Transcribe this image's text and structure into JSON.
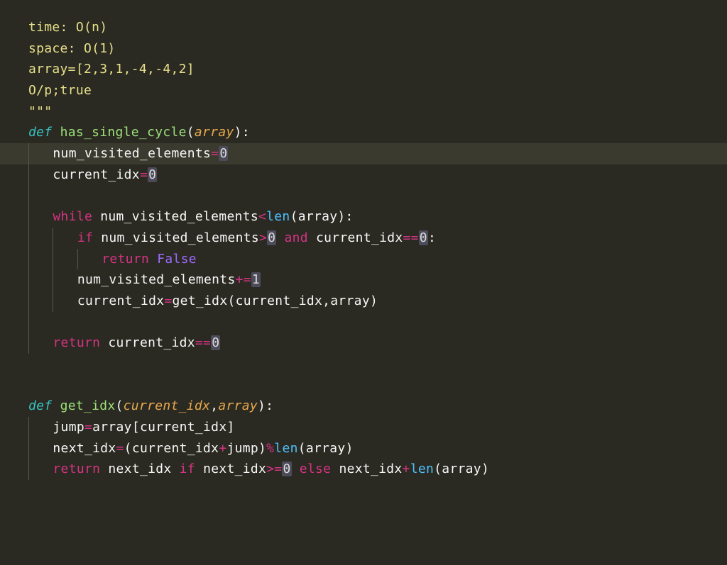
{
  "docstring": {
    "line1": "time: O(n)",
    "line2": "space: O(1)",
    "line3": "",
    "line4": "array=[2,3,1,-4,-4,2]",
    "line5": "O/p;true",
    "line6": "",
    "close": "\"\"\""
  },
  "kw": {
    "def": "def",
    "while": "while",
    "if": "if",
    "and": "and",
    "return": "return",
    "else": "else"
  },
  "fn": {
    "has_single_cycle": "has_single_cycle",
    "get_idx": "get_idx",
    "len": "len"
  },
  "param": {
    "array": "array",
    "current_idx": "current_idx"
  },
  "ident": {
    "num_visited_elements": "num_visited_elements",
    "current_idx": "current_idx",
    "array": "array",
    "jump": "jump",
    "next_idx": "next_idx"
  },
  "num": {
    "zero": "0",
    "one": "1"
  },
  "const": {
    "false": "False"
  },
  "op": {
    "assign": "=",
    "lt": "<",
    "gt": ">",
    "eq": "==",
    "ge": ">=",
    "plus_assign": "+=",
    "plus": "+",
    "mod": "%"
  },
  "p": {
    "lparen": "(",
    "rparen": ")",
    "colon": ":",
    "comma": ",",
    "lbrack": "[",
    "rbrack": "]"
  }
}
